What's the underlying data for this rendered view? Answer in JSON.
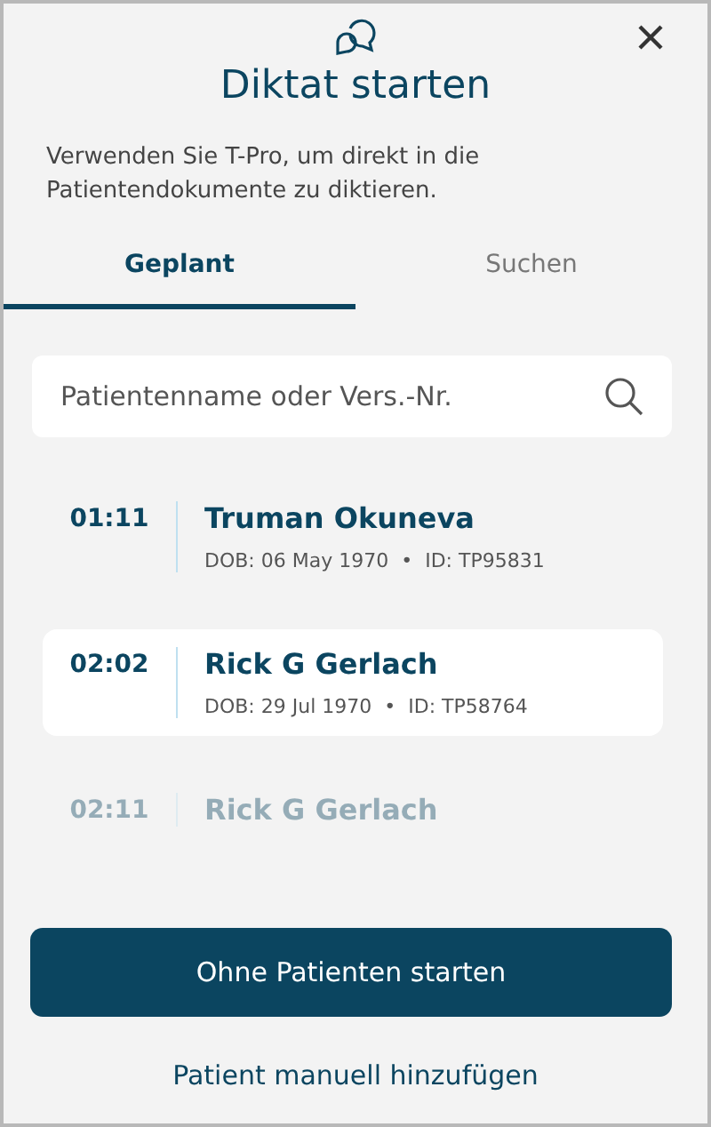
{
  "title": "Diktat starten",
  "description": "Verwenden Sie T-Pro, um direkt in die Patientendokumente zu diktieren.",
  "tabs": [
    {
      "label": "Geplant",
      "selected": true
    },
    {
      "label": "Suchen",
      "selected": false
    }
  ],
  "search": {
    "placeholder": "Patientenname oder Vers.-Nr."
  },
  "appointments": [
    {
      "time": "01:11",
      "name": "Truman Okuneva",
      "details": "DOB: 06 May 1970  •  ID: TP95831",
      "selected": false,
      "faded": false
    },
    {
      "time": "02:02",
      "name": "Rick G Gerlach",
      "details": "DOB: 29 Jul 1970  •  ID: TP58764",
      "selected": true,
      "faded": false
    },
    {
      "time": "02:11",
      "name": "Rick G Gerlach",
      "selected": false,
      "faded": true
    }
  ],
  "primary_button": "Ohne Patienten starten",
  "secondary_link": "Patient manuell hinzufügen"
}
